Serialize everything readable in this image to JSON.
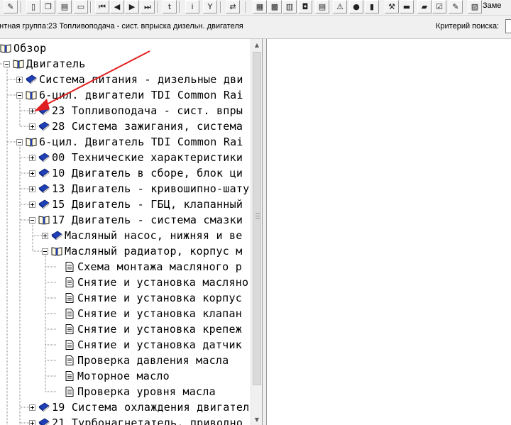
{
  "toolbar": {
    "buttons": [
      {
        "icon": "eraser-icon",
        "glyph": "✎"
      },
      {
        "icon": "new-document-icon",
        "glyph": "▯"
      },
      {
        "icon": "copy-icon",
        "glyph": "❐"
      },
      {
        "icon": "print-preview-icon",
        "glyph": "▤"
      },
      {
        "icon": "car-icon",
        "glyph": "▭"
      },
      {
        "icon": "first-icon",
        "glyph": "⏮"
      },
      {
        "icon": "previous-icon",
        "glyph": "◀"
      },
      {
        "icon": "next-icon",
        "glyph": "▶"
      },
      {
        "icon": "last-icon",
        "glyph": "⏭"
      },
      {
        "icon": "go-to-icon",
        "glyph": "t"
      },
      {
        "icon": "info-icon",
        "glyph": "i"
      },
      {
        "icon": "filter-icon",
        "glyph": "Y"
      },
      {
        "icon": "swap-icon",
        "glyph": "⇄"
      },
      {
        "icon": "calculator-icon",
        "glyph": "▦"
      },
      {
        "icon": "grid-icon",
        "glyph": "▩"
      },
      {
        "icon": "books-icon",
        "glyph": "▥"
      },
      {
        "icon": "gift-icon",
        "glyph": "◘"
      },
      {
        "icon": "document-icon",
        "glyph": "▤"
      },
      {
        "icon": "warning-icon",
        "glyph": "⚠"
      },
      {
        "icon": "globe-icon",
        "glyph": "●"
      },
      {
        "icon": "database-icon",
        "glyph": "▮"
      },
      {
        "icon": "wrench-icon",
        "glyph": "⚒"
      },
      {
        "icon": "car-green-icon",
        "glyph": "▬"
      },
      {
        "icon": "truck-icon",
        "glyph": "▰"
      },
      {
        "icon": "checklist-icon",
        "glyph": "☑"
      },
      {
        "icon": "notes-icon",
        "glyph": "✎"
      },
      {
        "icon": "layers-icon",
        "glyph": "▧"
      }
    ],
    "right_label": "Заме"
  },
  "info_bar": {
    "component_group": "онтная группа:23 Топливоподача - сист. впрыска дизельн. двигателя",
    "criteria_label": "Критерий  поиска:",
    "criteria_value": ""
  },
  "tree": [
    {
      "label": "Обзор",
      "level": 0,
      "expander": "minus",
      "icon": "open-book-icon"
    },
    {
      "label": "Двигатель",
      "level": 1,
      "expander": "minus",
      "icon": "open-book-icon"
    },
    {
      "label": "Система питания - дизельные дви",
      "level": 2,
      "expander": "plus",
      "icon": "closed-book-icon"
    },
    {
      "label": "6-цил. двигатели TDI Common Rai",
      "level": 2,
      "expander": "minus",
      "icon": "open-book-icon"
    },
    {
      "label": "23 Топливоподача - сист. впры",
      "level": 3,
      "expander": "plus",
      "icon": "closed-book-icon",
      "selected": true
    },
    {
      "label": "28 Система зажигания, система",
      "level": 3,
      "expander": "plus",
      "icon": "closed-book-icon"
    },
    {
      "label": "6-цил. Двигатель TDI Common Rai",
      "level": 2,
      "expander": "minus",
      "icon": "open-book-icon"
    },
    {
      "label": "00 Технические характеристики",
      "level": 3,
      "expander": "plus",
      "icon": "closed-book-icon"
    },
    {
      "label": "10 Двигатель в сборе, блок ци",
      "level": 3,
      "expander": "plus",
      "icon": "closed-book-icon"
    },
    {
      "label": "13 Двигатель - кривошипно-шату",
      "level": 3,
      "expander": "plus",
      "icon": "closed-book-icon"
    },
    {
      "label": "15 Двигатель - ГБЦ, клапанный",
      "level": 3,
      "expander": "plus",
      "icon": "closed-book-icon"
    },
    {
      "label": "17 Двигатель - система смазки",
      "level": 3,
      "expander": "minus",
      "icon": "open-book-icon"
    },
    {
      "label": "Масляный насос, нижняя и ве",
      "level": 4,
      "expander": "plus",
      "icon": "closed-book-icon"
    },
    {
      "label": "Масляный радиатор, корпус м",
      "level": 4,
      "expander": "minus",
      "icon": "open-book-icon"
    },
    {
      "label": "Схема монтажа масляного р",
      "level": 5,
      "expander": "none",
      "icon": "page-icon"
    },
    {
      "label": "Снятие и установка масляно",
      "level": 5,
      "expander": "none",
      "icon": "page-icon"
    },
    {
      "label": "Снятие и установка корпус",
      "level": 5,
      "expander": "none",
      "icon": "page-icon"
    },
    {
      "label": "Снятие и установка клапан",
      "level": 5,
      "expander": "none",
      "icon": "page-icon"
    },
    {
      "label": "Снятие и установка крепеж",
      "level": 5,
      "expander": "none",
      "icon": "page-icon"
    },
    {
      "label": "Снятие и установка датчик",
      "level": 5,
      "expander": "none",
      "icon": "page-icon"
    },
    {
      "label": "Проверка давления масла",
      "level": 5,
      "expander": "none",
      "icon": "page-icon"
    },
    {
      "label": "Моторное масло",
      "level": 5,
      "expander": "none",
      "icon": "page-icon"
    },
    {
      "label": "Проверка уровня масла",
      "level": 5,
      "expander": "none",
      "icon": "page-icon"
    },
    {
      "label": "19 Система охлаждения двигател",
      "level": 3,
      "expander": "plus",
      "icon": "closed-book-icon"
    },
    {
      "label": "21 Турбонагнетатель, приводно",
      "level": 3,
      "expander": "plus",
      "icon": "closed-book-icon"
    }
  ],
  "colors": {
    "book_blue": "#1f3fb8",
    "annotation_arrow": "#e02020",
    "tree_line": "#808080"
  }
}
